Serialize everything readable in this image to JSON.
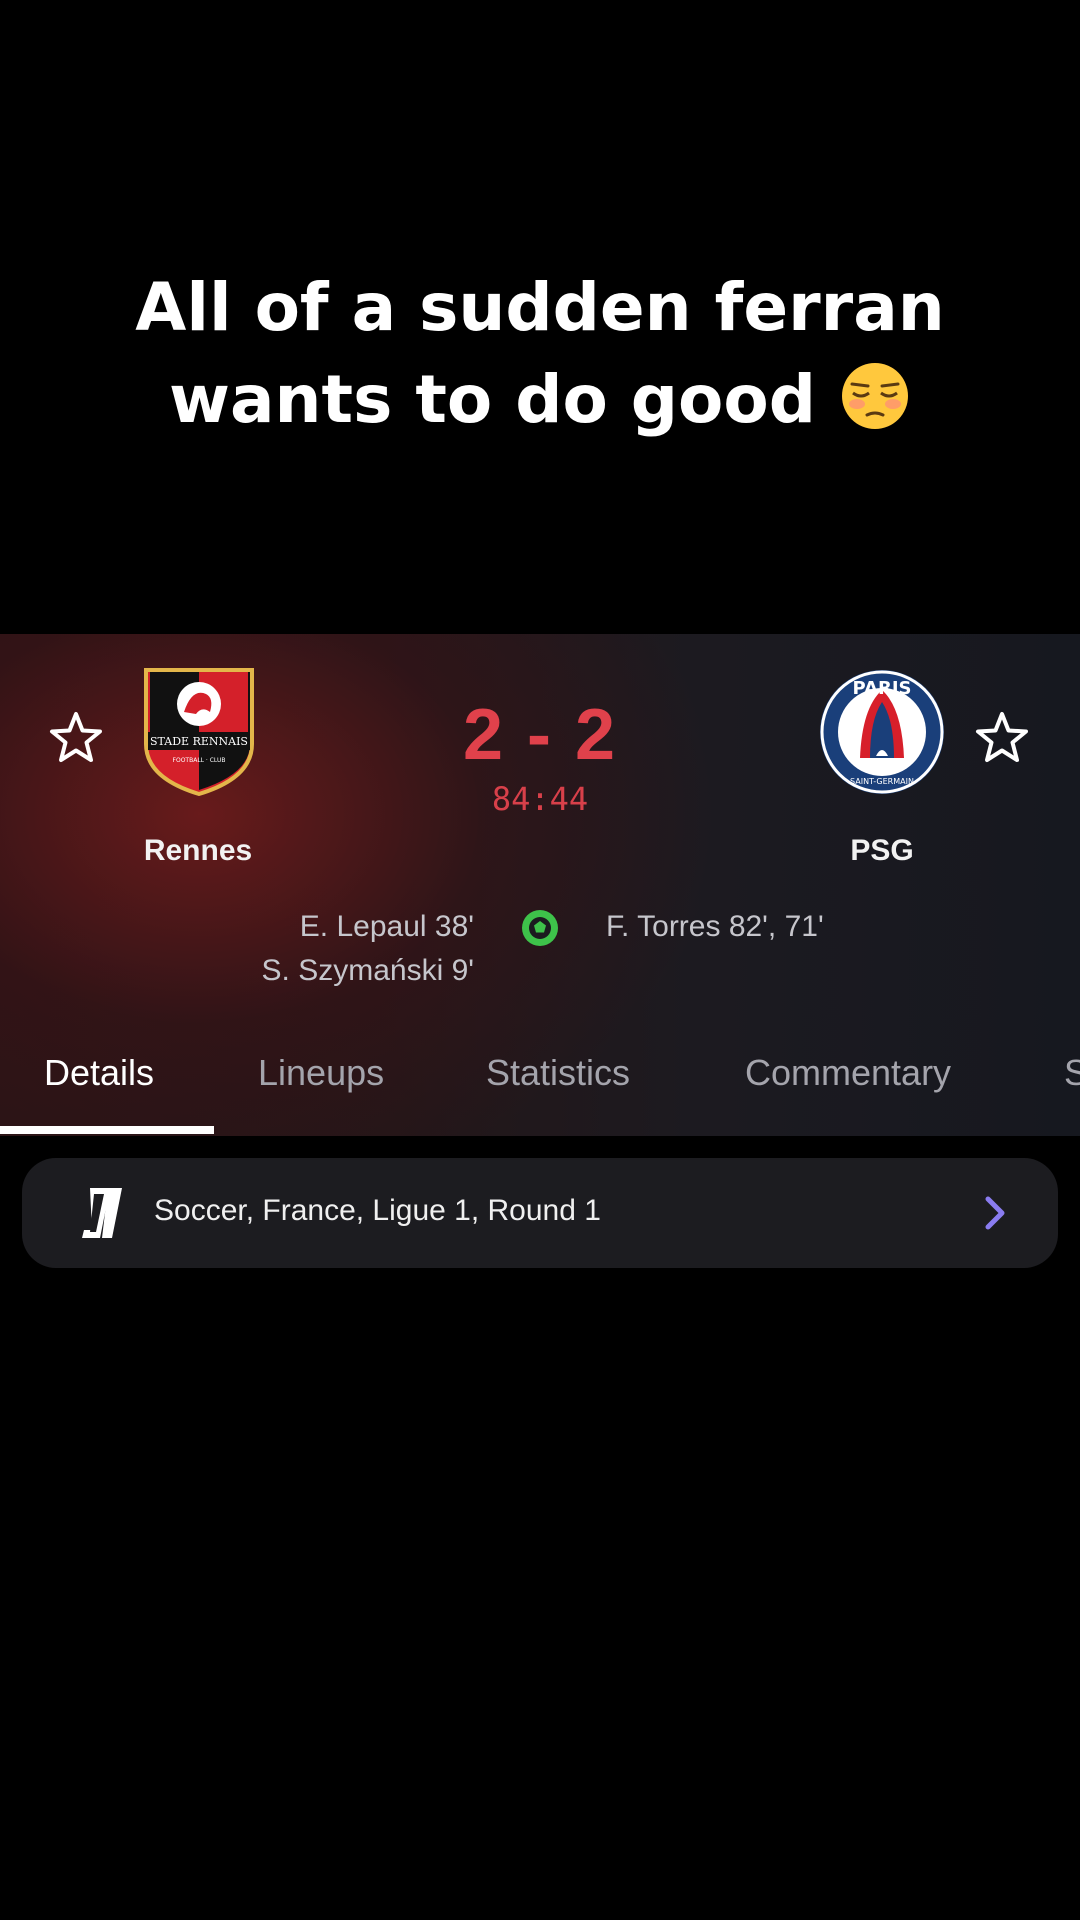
{
  "caption": {
    "line1": "All of a sudden ferran",
    "line2": "wants to do good",
    "emoji": "flushed-face-emoji"
  },
  "match": {
    "home_team": "Rennes",
    "away_team": "PSG",
    "score": "2 - 2",
    "clock": "84:44",
    "home_scorers": [
      "E. Lepaul 38'",
      "S. Szymański 9'"
    ],
    "away_scorers": [
      "F. Torres 82', 71'"
    ],
    "home_crest_text": "STADE RENNAIS",
    "away_crest_text": "PARIS"
  },
  "tabs": [
    "Details",
    "Lineups",
    "Statistics",
    "Commentary",
    "S"
  ],
  "league": {
    "label": "Soccer, France, Ligue 1, Round 1"
  },
  "colors": {
    "score_red": "#e0414b",
    "ball_green": "#3ec24a",
    "chevron_purple": "#8a7cf0",
    "psg_blue": "#1a3f7a",
    "psg_red": "#d71f2a",
    "rennes_red": "#d4202a"
  },
  "icons": {
    "favorite": "star-outline-icon",
    "goal": "soccer-ball-icon",
    "navigate": "chevron-right-icon",
    "league": "ligue1-logo"
  }
}
